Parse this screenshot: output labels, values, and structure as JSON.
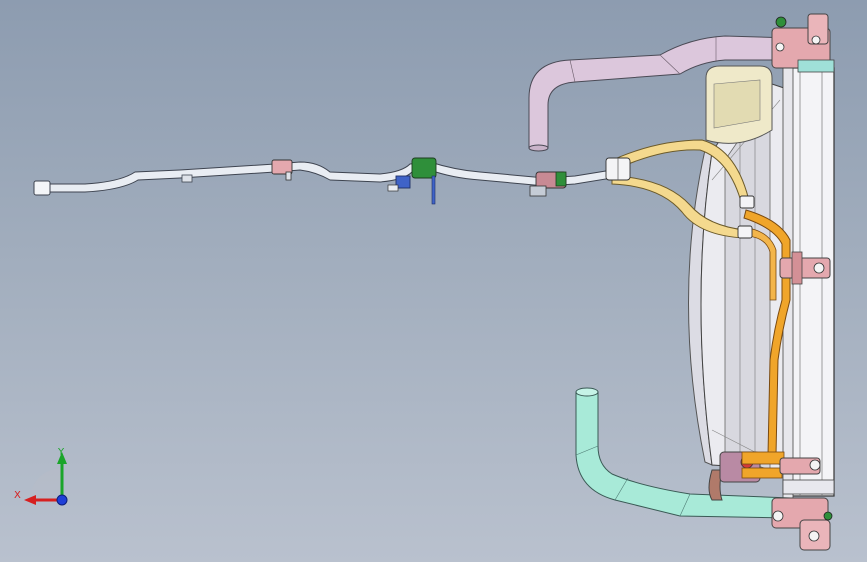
{
  "viewport": {
    "background_top": "#8d9cb0",
    "background_bottom": "#b9c1ce"
  },
  "colors": {
    "upper_hose": "#dcc7dc",
    "lower_hose": "#a8ead8",
    "small_hose": "#f4d98e",
    "orange_pipe": "#f0a52a",
    "harness": "#e9edf3",
    "bracket_pink": "#e4a8ae",
    "clip_green": "#2f8f3a",
    "clip_blue": "#3f63c8",
    "fan_shroud": "#ebebf0",
    "radiator": "#f4f4f7",
    "tank": "#efe9c9"
  },
  "triad": {
    "x_label": "X",
    "y_label": "Y",
    "x_color": "#d62020",
    "y_color": "#1aa52a",
    "z_color": "#1f3fd8"
  }
}
